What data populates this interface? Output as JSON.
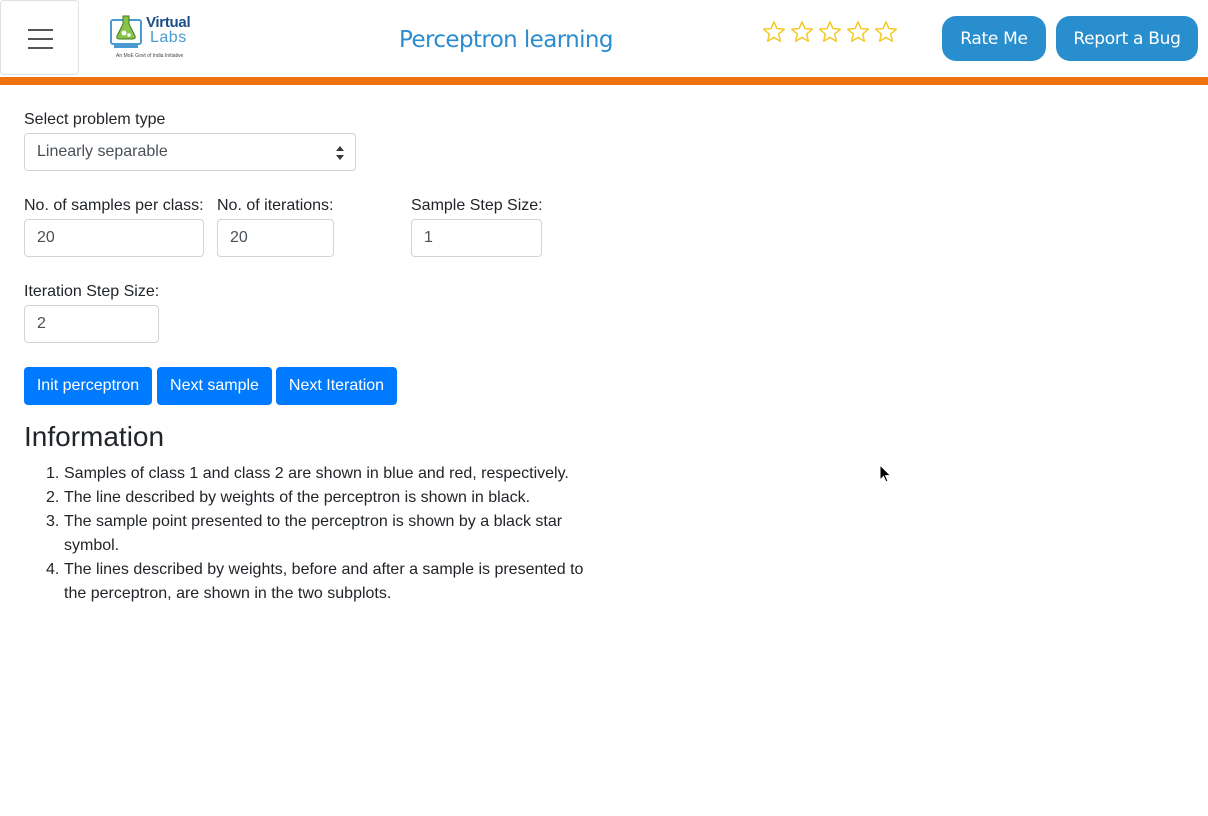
{
  "header": {
    "logo": {
      "line1": "Virtual",
      "line2": "Labs",
      "tagline": "An MoE Govt of India Initiative"
    },
    "title": "Perceptron learning",
    "rating": {
      "stars_filled": 0,
      "stars_total": 5
    },
    "rate_me_label": "Rate Me",
    "report_bug_label": "Report a Bug",
    "colors": {
      "accent_orange": "#f0720f",
      "pill_blue": "#288ecd",
      "title_blue": "#2b8ccf",
      "star_gold": "#f5c518"
    }
  },
  "form": {
    "problem_type_label": "Select problem type",
    "problem_type_selected": "Linearly separable",
    "samples_label": "No. of samples per class:",
    "samples_value": "20",
    "iterations_label": "No. of iterations:",
    "iterations_value": "20",
    "sample_step_label": "Sample Step Size:",
    "sample_step_value": "1",
    "iteration_step_label": "Iteration Step Size:",
    "iteration_step_value": "2"
  },
  "buttons": {
    "init": "Init perceptron",
    "next_sample": "Next sample",
    "next_iteration": "Next Iteration",
    "color": "#007bff"
  },
  "information": {
    "heading": "Information",
    "items": [
      {
        "num": "1.",
        "text": "Samples of class 1 and class 2 are shown in blue and red, respectively."
      },
      {
        "num": "2.",
        "text": "The line described by weights of the perceptron is shown in black."
      },
      {
        "num": "3.",
        "text": "The sample point presented to the perceptron is shown by a black star symbol."
      },
      {
        "num": "4.",
        "text": "The lines described by weights, before and after a sample is presented to the perceptron, are shown in the two subplots."
      }
    ]
  }
}
